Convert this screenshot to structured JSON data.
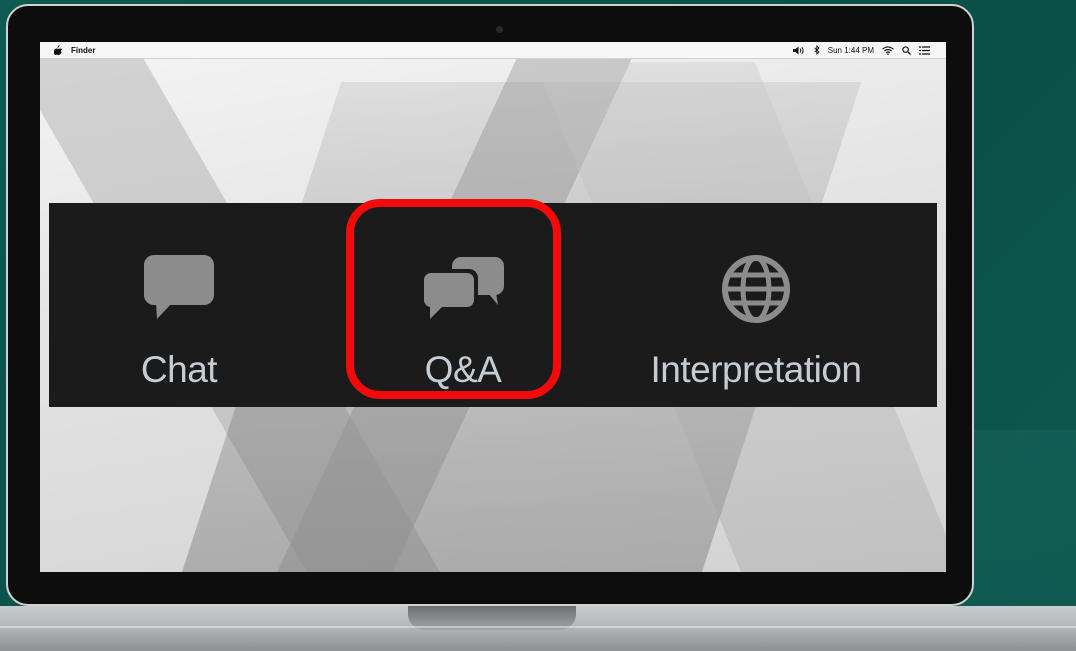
{
  "menubar": {
    "app_name": "Finder",
    "clock": "Sun 1:44 PM",
    "icons": [
      "apple-icon",
      "volume-icon",
      "bluetooth-icon",
      "wifi-icon",
      "search-icon",
      "menu-list-icon"
    ]
  },
  "toolbar": {
    "items": [
      {
        "label": "Chat",
        "icon": "chat-bubble-icon"
      },
      {
        "label": "Q&A",
        "icon": "qa-bubbles-icon",
        "highlighted": true
      },
      {
        "label": "Interpretation",
        "icon": "globe-icon"
      }
    ]
  },
  "colors": {
    "background": "#0e5950",
    "toolbar": "#1b1b1b",
    "icon": "#8c8c8c",
    "label": "#c4cdd6",
    "highlight": "#f40a0a"
  }
}
